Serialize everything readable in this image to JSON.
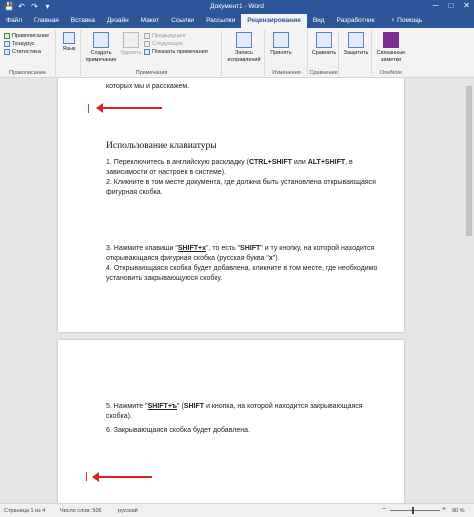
{
  "titlebar": {
    "title": "Документ1 - Word",
    "qat": [
      "💾",
      "↶",
      "↷",
      "▾"
    ],
    "controls": [
      "─",
      "□",
      "✕"
    ]
  },
  "tabs": [
    {
      "label": "Файл"
    },
    {
      "label": "Главная"
    },
    {
      "label": "Вставка"
    },
    {
      "label": "Дизайн"
    },
    {
      "label": "Макет"
    },
    {
      "label": "Ссылки"
    },
    {
      "label": "Рассылки"
    },
    {
      "label": "Рецензирование"
    },
    {
      "label": "Вид"
    },
    {
      "label": "Разработчик"
    }
  ],
  "help": "♀ Помощь",
  "ribbon": {
    "spelling": "Правописание",
    "thesaurus": "Тезаурус",
    "stats": "Статистика",
    "proofing_label": "Правописание",
    "language": "Язык",
    "new_comment": "Создать примечание",
    "delete": "Удалить",
    "previous": "Предыдущее",
    "next": "Следующее",
    "show_comments": "Показать примечания",
    "comments_label": "Примечания",
    "track_changes": "Запись исправлений",
    "accept": "Принять",
    "changes_label": "Изменения",
    "compare": "Сравнить",
    "compare_label": "Сравнение",
    "protect": "Защитить",
    "linked_notes": "Связанные заметки",
    "onenote_label": "OneNote"
  },
  "document": {
    "line_top": "которых мы и расскажем.",
    "heading": "Использование клавиатуры",
    "p1_a": "1. Переключитесь в английскую раскладку (",
    "p1_k1": "CTRL+SHIFT",
    "p1_b": " или ",
    "p1_k2": "ALT+SHIFT",
    "p1_c": ", в зависимости от настроек в системе).",
    "p2": "2. Кликните в том месте документа, где должна быть установлена открывающаяся фигурная скобка.",
    "p3_a": "3. Нажмите клавиши \"",
    "p3_k1": "SHIFT+х",
    "p3_b": "\", то есть \"",
    "p3_k2": "SHIFT",
    "p3_c": "\" и ту кнопку, на которой находится открывающаяся фигурная скобка (русская буква \"",
    "p3_k3": "х",
    "p3_d": "\").",
    "p4": "4. Открывающаяся скобка будет добавлена, кликните в том месте, где необходимо установить закрывающуюся скобку.",
    "p5_a": "5. Нажмите \"",
    "p5_k1": "SHIFT+ъ",
    "p5_b": "\" (",
    "p5_k2": "SHIFT",
    "p5_c": " и кнопка, на которой находится закрывающаяся скобка).",
    "p6": "6. Закрывающаяся скобка будет добавлена."
  },
  "status": {
    "page": "Страница 1 из 4",
    "words": "Число слов: 506",
    "lang": "русский",
    "zoom": "90 %",
    "zoom_minus": "−",
    "zoom_plus": "+",
    "zoom_level_percent": 90
  },
  "colors": {
    "accent": "#2b579a",
    "annotation_red": "#d22222"
  }
}
